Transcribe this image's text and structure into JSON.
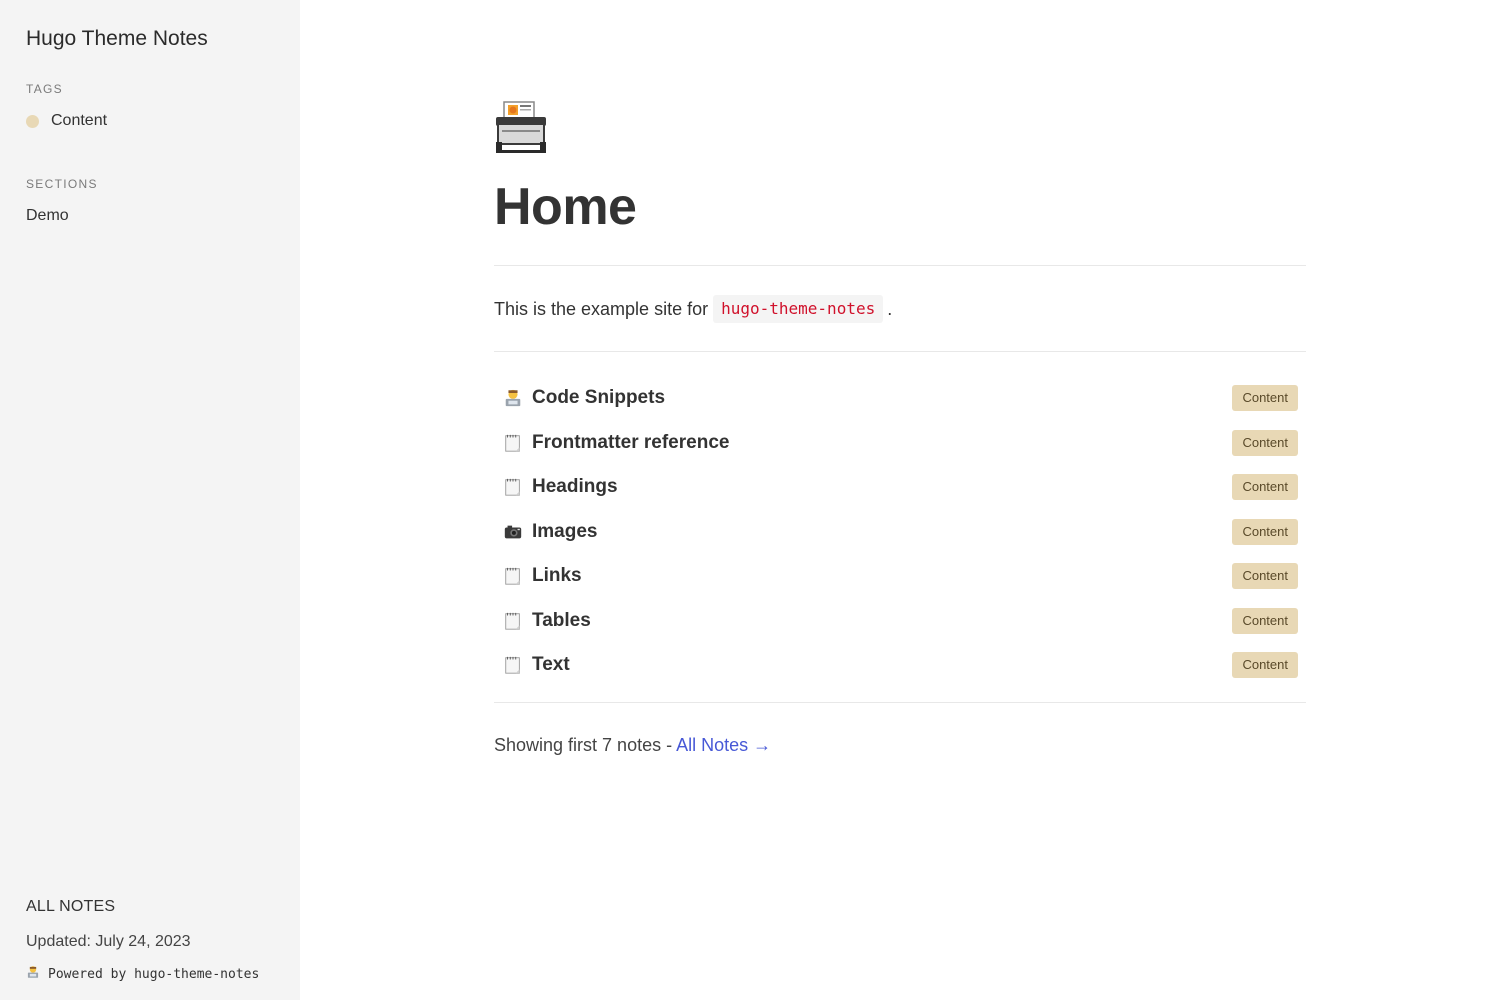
{
  "sidebar": {
    "site_title": "Hugo Theme Notes",
    "tags_heading": "TAGS",
    "tags": [
      {
        "label": "Content",
        "color": "#e8d8b5"
      }
    ],
    "sections_heading": "SECTIONS",
    "sections": [
      {
        "label": "Demo"
      }
    ],
    "all_notes_label": "ALL NOTES",
    "updated_text": "Updated: July 24, 2023",
    "powered_icon": "technologist-icon",
    "powered_text": "Powered by hugo-theme-notes"
  },
  "main": {
    "page_icon": "printer-icon",
    "title": "Home",
    "intro_prefix": "This is the example site for",
    "intro_code": "hugo-theme-notes",
    "intro_suffix": ".",
    "notes": [
      {
        "icon": "technologist-icon",
        "title": "Code Snippets",
        "tag": "Content"
      },
      {
        "icon": "spiral-notepad-icon",
        "title": "Frontmatter reference",
        "tag": "Content"
      },
      {
        "icon": "spiral-notepad-icon",
        "title": "Headings",
        "tag": "Content"
      },
      {
        "icon": "camera-icon",
        "title": "Images",
        "tag": "Content"
      },
      {
        "icon": "spiral-notepad-icon",
        "title": "Links",
        "tag": "Content"
      },
      {
        "icon": "spiral-notepad-icon",
        "title": "Tables",
        "tag": "Content"
      },
      {
        "icon": "spiral-notepad-icon",
        "title": "Text",
        "tag": "Content"
      }
    ],
    "showing_text": "Showing first 7 notes -",
    "all_notes_link": "All Notes →"
  },
  "colors": {
    "sidebar_bg": "#f4f4f4",
    "tag_badge_bg": "#e8d8b5",
    "code_text": "#d0112b",
    "link": "#4758d6"
  }
}
